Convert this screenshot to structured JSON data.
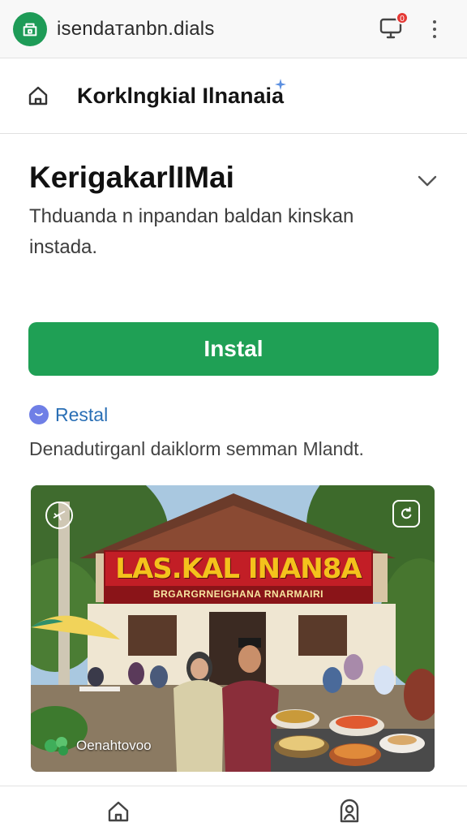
{
  "topbar": {
    "title": "isendaтanbn.dials",
    "notification_count": "0",
    "app_icon": "store-icon",
    "notification_icon": "monitor-alert-icon",
    "menu_icon": "more-vert-icon"
  },
  "subheader": {
    "title": "Korklngkial Ilnanaia",
    "home_icon": "home-icon"
  },
  "content": {
    "title": "KerigakarlIMai",
    "description": "Thduanda n inpandan baldan kinskan instada.",
    "install_label": "Instal",
    "status_label": "Restal",
    "subtext": "Denadutirganl daiklorm semman Mlandt."
  },
  "photo": {
    "banner_main": "LAS.KAL INAN8A",
    "banner_sub": "BRGARGRNEIGHANA RNARMAIRI",
    "caption": "Oenahtovoo"
  },
  "colors": {
    "brand_green": "#1fa055",
    "status_blue": "#2a6fb5",
    "badge_red": "#e53935"
  },
  "bottom_nav": {
    "items": [
      {
        "icon": "home-icon"
      },
      {
        "icon": "profile-icon"
      }
    ]
  }
}
